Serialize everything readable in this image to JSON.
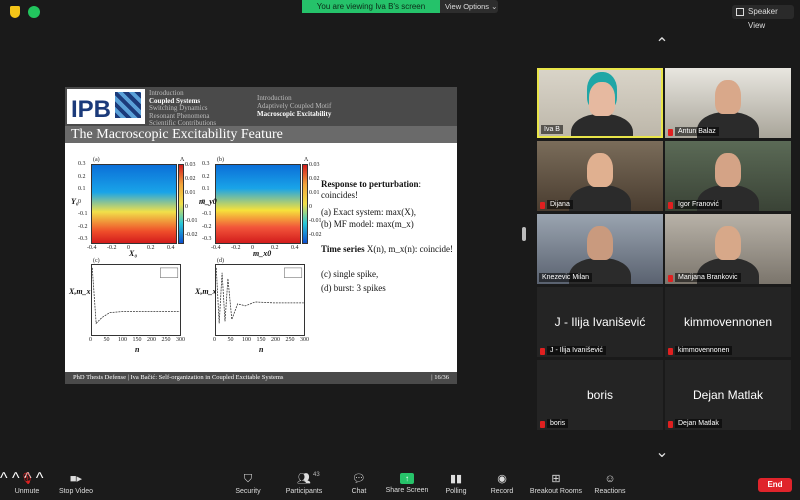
{
  "banner": {
    "viewing": "You are viewing Iva B's screen",
    "view_options": "View Options ⌄"
  },
  "speaker_view_label": "Speaker View",
  "slide": {
    "nav_left": [
      "Introduction",
      "Coupled Systems",
      "Switching Dynamics",
      "Resonant Phenomena",
      "Scientific Contributions"
    ],
    "nav_left_active": 1,
    "nav_right": [
      "Introduction",
      "Adaptively Coupled Motif",
      "Macroscopic Excitability"
    ],
    "nav_right_active": 2,
    "logo": "IPB",
    "title": "The Macroscopic Excitability Feature",
    "panel_a": "(a)",
    "panel_b": "(b)",
    "panel_c": "(c)",
    "panel_d": "(d)",
    "axis_yr": "Y₀",
    "axis_ym": "m_y0",
    "axis_xr": "X₀",
    "axis_xm": "m_x0",
    "axis_n": "n",
    "axis_xm_series": "X,m_x",
    "lambda": "Λ",
    "cbar_ticks": [
      "0.03",
      "0.02",
      "0.01",
      "0",
      "-0.01",
      "-0.02"
    ],
    "x_ticks_heat": [
      "-0.4",
      "-0.2",
      "0",
      "0.2",
      "0.4"
    ],
    "y_ticks_heat": [
      "0.3",
      "0.2",
      "0.1",
      "0",
      "-0.1",
      "-0.2",
      "-0.3"
    ],
    "n_ticks": [
      "0",
      "50",
      "100",
      "150",
      "200",
      "250",
      "300"
    ],
    "legend": [
      "X",
      "m_x"
    ],
    "text_response": "Response to perturbation",
    "text_coincides": ": coincides!",
    "text_a": "(a) Exact system: max(X),",
    "text_b": "(b) MF model: max(m_x)",
    "text_time": "Time series",
    "text_time_rest": " X(n), m_x(n): coincide!",
    "text_c": "(c) single spike,",
    "text_d": "(d) burst: 3 spikes",
    "footer_left": "PhD Thesis Defense   |   Iva Bačić: Self-organization in Coupled Excitable Systems",
    "footer_right": "|   16/36"
  },
  "participants": [
    {
      "name": "Iva B",
      "muted": false,
      "active": true,
      "video": true
    },
    {
      "name": "Antun Balaz",
      "muted": true,
      "active": false,
      "video": true
    },
    {
      "name": "Dijana",
      "muted": true,
      "active": false,
      "video": true
    },
    {
      "name": "Igor Franović",
      "muted": true,
      "active": false,
      "video": true
    },
    {
      "name": "Knezevic Milan",
      "muted": false,
      "active": false,
      "video": true
    },
    {
      "name": "Marijana Brankovic",
      "muted": true,
      "active": false,
      "video": true
    },
    {
      "name": "J - Ilija Ivanišević",
      "muted": true,
      "active": false,
      "video": false
    },
    {
      "name": "kimmovennonen",
      "muted": true,
      "active": false,
      "video": false
    },
    {
      "name": "boris",
      "muted": true,
      "active": false,
      "video": false
    },
    {
      "name": "Dejan Matlak",
      "muted": true,
      "active": false,
      "video": false
    }
  ],
  "toolbar": {
    "unmute": "Unmute",
    "stop_video": "Stop Video",
    "security": "Security",
    "participants": "Participants",
    "participants_count": "43",
    "chat": "Chat",
    "share_screen": "Share Screen",
    "polling": "Polling",
    "record": "Record",
    "breakout": "Breakout Rooms",
    "reactions": "Reactions",
    "end": "End"
  },
  "colors": {
    "accent_green": "#25c26a",
    "end_red": "#e0242b",
    "active_border": "#e9e54a",
    "mute_red": "#e02020"
  }
}
